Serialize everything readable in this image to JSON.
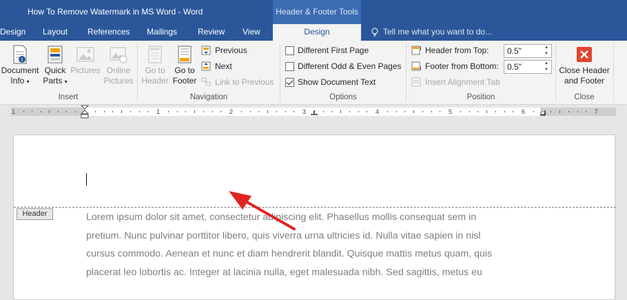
{
  "window": {
    "title": "How To Remove Watermark in MS Word - Word",
    "contextual_group": "Header & Footer Tools"
  },
  "tabs": [
    {
      "label": "Design",
      "active": false
    },
    {
      "label": "Layout",
      "active": false
    },
    {
      "label": "References",
      "active": false
    },
    {
      "label": "Mailings",
      "active": false
    },
    {
      "label": "Review",
      "active": false
    },
    {
      "label": "View",
      "active": false
    },
    {
      "label": "Design",
      "active": true
    }
  ],
  "tell_me": "Tell me what you want to do...",
  "ribbon": {
    "insert": {
      "label": "Insert",
      "document_info": {
        "line1": "Document",
        "line2": "Info"
      },
      "quick_parts": {
        "line1": "Quick",
        "line2": "Parts"
      },
      "pictures": "Pictures",
      "online_pictures": {
        "line1": "Online",
        "line2": "Pictures"
      }
    },
    "navigation": {
      "label": "Navigation",
      "go_to_header": {
        "line1": "Go to",
        "line2": "Header"
      },
      "go_to_footer": {
        "line1": "Go to",
        "line2": "Footer"
      },
      "previous": "Previous",
      "next": "Next",
      "link_to_previous": "Link to Previous"
    },
    "options": {
      "label": "Options",
      "different_first_page": {
        "label": "Different First Page",
        "checked": false
      },
      "different_odd_even": {
        "label": "Different Odd & Even Pages",
        "checked": false
      },
      "show_document_text": {
        "label": "Show Document Text",
        "checked": true
      }
    },
    "position": {
      "label": "Position",
      "header_from_top": {
        "label": "Header from Top:",
        "value": "0.5\""
      },
      "footer_from_bottom": {
        "label": "Footer from Bottom:",
        "value": "0.5\""
      },
      "insert_alignment_tab": "Insert Alignment Tab"
    },
    "close": {
      "label": "Close",
      "close_button": {
        "line1": "Close Header",
        "line2": "and Footer"
      }
    }
  },
  "ruler": {
    "numbers": [
      "1",
      "1",
      "2",
      "3",
      "4",
      "5",
      "6",
      "7"
    ]
  },
  "document": {
    "header_tag": "Header",
    "body_lines": [
      "Lorem ipsum dolor sit amet, consectetur adipiscing elit. Phasellus mollis consequat sem in",
      "pretium. Nunc pulvinar porttitor libero, quis viverra urna ultricies id. Nulla vitae sapien in nisl",
      "cursus commodo. Aenean et nunc et diam hendrerit blandit. Quisque mattis metus quam, quis",
      "placerat leo lobortis ac. Integer at lacinia nulla, eget malesuada nibh. Sed sagittis, metus eu"
    ]
  },
  "colors": {
    "title_bar": "#2b579a",
    "contextual_tab": "#3c6db2",
    "ribbon": "#f3f3f3",
    "annotation_arrow": "#e02424",
    "close_button": "#e0452f"
  }
}
